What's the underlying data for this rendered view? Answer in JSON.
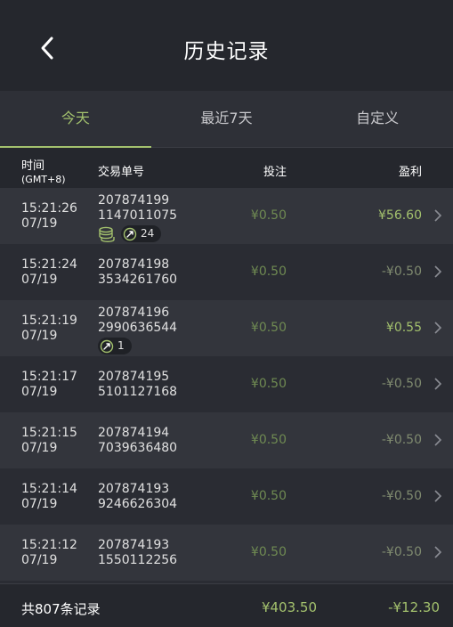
{
  "header": {
    "title": "历史记录"
  },
  "tabs": [
    {
      "label": "今天",
      "active": true
    },
    {
      "label": "最近7天",
      "active": false
    },
    {
      "label": "自定义",
      "active": false
    }
  ],
  "columns": {
    "time": "时间",
    "time_sub": "(GMT+8)",
    "order": "交易单号",
    "bet": "投注",
    "profit": "盈利"
  },
  "rows": [
    {
      "time": "15:21:26",
      "date": "07/19",
      "order_a": "207874199",
      "order_b": "1147011075",
      "bet": "¥0.50",
      "profit": "¥56.60",
      "win": true,
      "coins": true,
      "badge": "24"
    },
    {
      "time": "15:21:24",
      "date": "07/19",
      "order_a": "207874198",
      "order_b": "3534261760",
      "bet": "¥0.50",
      "profit": "-¥0.50",
      "win": false
    },
    {
      "time": "15:21:19",
      "date": "07/19",
      "order_a": "207874196",
      "order_b": "2990636544",
      "bet": "¥0.50",
      "profit": "¥0.55",
      "win": true,
      "coins": false,
      "badge": "1"
    },
    {
      "time": "15:21:17",
      "date": "07/19",
      "order_a": "207874195",
      "order_b": "5101127168",
      "bet": "¥0.50",
      "profit": "-¥0.50",
      "win": false
    },
    {
      "time": "15:21:15",
      "date": "07/19",
      "order_a": "207874194",
      "order_b": "7039636480",
      "bet": "¥0.50",
      "profit": "-¥0.50",
      "win": false
    },
    {
      "time": "15:21:14",
      "date": "07/19",
      "order_a": "207874193",
      "order_b": "9246626304",
      "bet": "¥0.50",
      "profit": "-¥0.50",
      "win": false
    },
    {
      "time": "15:21:12",
      "date": "07/19",
      "order_a": "207874193",
      "order_b": "1550112256",
      "bet": "¥0.50",
      "profit": "-¥0.50",
      "win": false
    }
  ],
  "footer": {
    "count": "共807条记录",
    "total_bet": "¥403.50",
    "total_profit": "-¥12.30"
  },
  "colors": {
    "accent": "#a3c16d",
    "background": "#2a2c33",
    "header_bg": "#25272d"
  },
  "icons": {
    "back": "chevron-left-icon",
    "row": "chevron-right-icon",
    "coins": "coins-stack-icon",
    "badge": "spin-arrow-icon"
  }
}
